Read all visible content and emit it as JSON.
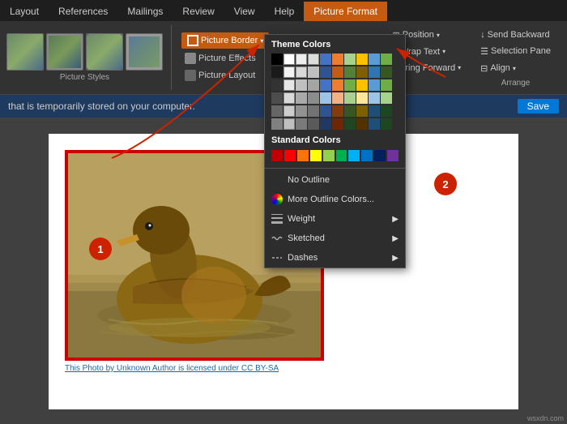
{
  "ribbon": {
    "tabs": [
      {
        "label": "Layout",
        "active": false
      },
      {
        "label": "References",
        "active": false
      },
      {
        "label": "Mailings",
        "active": false
      },
      {
        "label": "Review",
        "active": false
      },
      {
        "label": "View",
        "active": false
      },
      {
        "label": "Help",
        "active": false
      },
      {
        "label": "Picture Format",
        "active": true
      }
    ],
    "picture_styles_label": "Picture Styles",
    "picture_border_label": "Picture Border",
    "picture_border_arrow": "▾",
    "picture_effects_label": "Picture Effects",
    "picture_layout_label": "Picture Layout",
    "position_label": "Position",
    "position_arrow": "▾",
    "wrap_text_label": "Wrap Text",
    "wrap_text_arrow": "▾",
    "bring_forward_label": "Bring Forward",
    "bring_forward_arrow": "▾",
    "send_backward_label": "Send Backward",
    "selection_pane_label": "Selection Pane",
    "align_label": "Align",
    "align_arrow": "▾",
    "arrange_label": "Arrange"
  },
  "save_bar": {
    "text": "that is temporarily stored on your computer.",
    "button_label": "Save"
  },
  "dropdown": {
    "theme_colors_label": "Theme Colors",
    "standard_colors_label": "Standard Colors",
    "no_outline_label": "No Outline",
    "more_outline_colors_label": "More Outline Colors...",
    "weight_label": "Weight",
    "sketched_label": "Sketched",
    "dashes_label": "Dashes",
    "theme_colors": [
      [
        "#000000",
        "#ffffff",
        "#eeeeee",
        "#dddddd",
        "#4472c4",
        "#ed7d31",
        "#a9d18e",
        "#ffc000",
        "#5b9bd5",
        "#70ad47"
      ],
      [
        "#1a1a1a",
        "#f2f2f2",
        "#d8d8d8",
        "#bfbfbf",
        "#2f5496",
        "#c55a11",
        "#538135",
        "#7f6000",
        "#2e75b6",
        "#375623"
      ],
      [
        "#333333",
        "#e6e6e6",
        "#c0c0c0",
        "#a5a5a5",
        "#4472c4",
        "#ed7d31",
        "#70ad47",
        "#ffc000",
        "#5b9bd5",
        "#70ad47"
      ],
      [
        "#4d4d4d",
        "#d9d9d9",
        "#a9a9a9",
        "#8c8c8c",
        "#9dc3e6",
        "#f4b183",
        "#a9d18e",
        "#ffe699",
        "#9dc3e6",
        "#a9d18e"
      ],
      [
        "#666666",
        "#cccccc",
        "#929292",
        "#737373",
        "#2f5496",
        "#843c0c",
        "#375623",
        "#7f6000",
        "#1f4e79",
        "#1e4620"
      ],
      [
        "#808080",
        "#bfbfbf",
        "#7a7a7a",
        "#5a5a5a",
        "#1f3864",
        "#6d2704",
        "#1e4620",
        "#543100",
        "#1f4e79",
        "#1e4620"
      ]
    ],
    "standard_colors": [
      "#c00000",
      "#ff0000",
      "#ff7300",
      "#ffff00",
      "#92d050",
      "#00b050",
      "#00b0f0",
      "#0070c0",
      "#002060",
      "#7030a0"
    ]
  },
  "annotations": [
    {
      "id": "1",
      "label": "1"
    },
    {
      "id": "2",
      "label": "2"
    }
  ],
  "caption": {
    "text": "This Photo by Unknown Author is licensed under CC BY-SA"
  },
  "wsxdn": "wsxdn.com"
}
